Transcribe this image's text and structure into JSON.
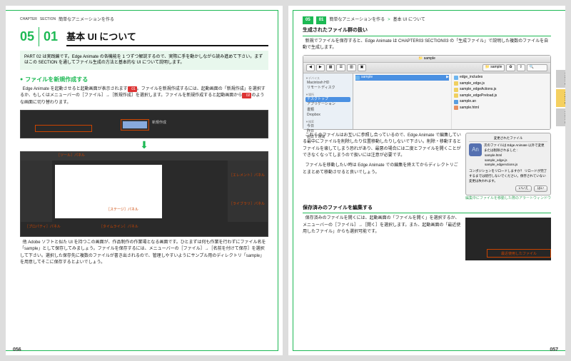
{
  "left": {
    "hdr": {
      "chapter_lbl": "CHAPTER",
      "section_lbl": "SECTION",
      "trail": "簡単なアニメーションを作る"
    },
    "chapter_num": "05",
    "section_num": "01",
    "title": "基本 UI について",
    "intro": "PART 02 は実践編です。Edge Animate の各機能を 1 つずつ解説するので、実際に手を動かしながら読み進めて下さい。まずはこの SECTION を通してファイル生成の方法と基本的な UI について説明します。",
    "h1": "ファイルを新規作成する",
    "p1a": "Edge Animate を起動させると起動画面が表示されます",
    "badge1": "01",
    "p1b": "。ファイルを新規作成するには、起動画面の「新規作成」を選択するか、もしくはメニューバーの［ファイル］→［新規作成］を選択します。ファイルを新規作成すると起動画面から",
    "badge2": "02",
    "p1c": "のような画面に切り替わります。",
    "shot1_label": "新規作成",
    "panel_labels": {
      "tools": "［ツール］パネル",
      "elements": "［エレメント］パネル",
      "stage": "［ステージ］パネル",
      "library": "［ライブラリ］パネル",
      "property": "［プロパティ］パネル",
      "timeline": "［タイムライン］パネル"
    },
    "p2": "他 Adobe ソフトと似た UI を持つこの画面が、作品制作の作業場となる画面です。ひとまずは何も作業を行わずにファイル名を「sample」として保存してみましょう。ファイルを保存するには、メニューバーの［ファイル］→［名前を付けて保存］を選択して下さい。選択した保存先に複数のファイルが書き出されるので、管理しやすいようにサンプル用のディレクトリ「sample」を用意してそこに保存するとよいでしょう。",
    "pagenum": "056"
  },
  "right": {
    "hdr": {
      "ch": "05",
      "sec": "01",
      "trail": "簡単なアニメーションを作る",
      "sep": ">",
      "sub": "基本 UI について"
    },
    "h1": "生成されたファイル群の扱い",
    "p1": "新規でファイルを保存すると、Edge Animate は CHAPTER03 SECTION03 の「生成ファイル」で説明した複数のファイルを自動で生成します。",
    "finder": {
      "title": "sample",
      "path_segment": "sample",
      "sidebar": {
        "device_cat": "▼デバイス",
        "device1": "Macintosh HD",
        "device2": "リモートディスク",
        "place_cat": "▼場所",
        "desktop": "デスクトップ",
        "apps": "アプリケーション",
        "docs": "書類",
        "dropbox": "Dropbox",
        "search_cat": "▼検索",
        "today": "今日",
        "yesterday": "昨日",
        "week": "過去 1 週間"
      },
      "col1_item": "sample",
      "files": [
        "edge_includes",
        "sample_edge.js",
        "sample_edgeActions.js",
        "sample_edgePreload.js",
        "sample.an",
        "sample.html"
      ]
    },
    "p2": "これらのファイルはお互いに参照し合っているので、Edge Animate で編集している最中にファイルを削除したり位置移動したりしないで下さい。削除・移動するとファイルを壊してしまう恐れがあり、最悪の場合には二度とファイルを開くことができなくなってしまうので扱いには注意が必要です。",
    "p3": "ファイルを移動したい時は Edge Animate での編集を終えてからディレクトリごとまとめて移動させると良いでしょう。",
    "alert": {
      "title": "変更されたファイル",
      "msg1": "次のファイルは Edge Animate 以外で変更または削除されました :",
      "f1": "sample.html",
      "f2": "sample_edge.js",
      "f3": "sample_edgeActions.js",
      "msg2": "コンポジションをリロードしますか？ リロードが完了するまでは続行しないでください。保存されていない変更は失われます。",
      "btn_no": "いいえ",
      "btn_yes": "はい"
    },
    "alert_caption": "編集中にファイルを移動した際のアラートウィンドウ",
    "h2": "保存済みのファイルを編集する",
    "p4": "保存済みのファイルを開くには、起動画面の「ファイルを開く」を選択するか、メニューバーの［ファイル］→［開く］を選択します。また、起動画面の「最近使用したファイル」からも選択可能です。",
    "recent_label": "最近使用したファイル",
    "pagenum": "057",
    "side_tabs": {
      "a": "PART 1",
      "b": "PART 2",
      "c": "PART 3"
    }
  }
}
